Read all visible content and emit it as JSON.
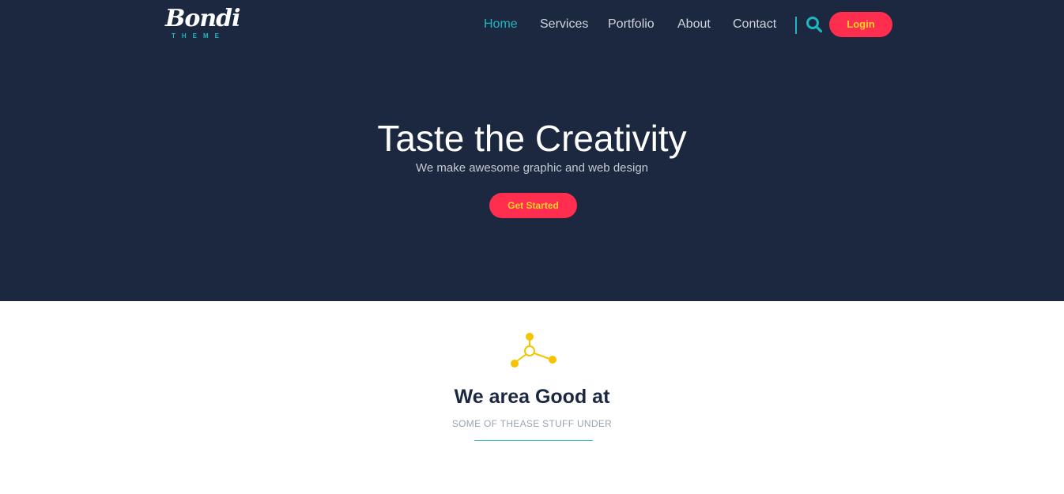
{
  "brand": {
    "name": "Bondi",
    "sub": "THEME"
  },
  "nav": {
    "items": [
      {
        "label": "Home",
        "active": true
      },
      {
        "label": "Services",
        "active": false
      },
      {
        "label": "Portfolio",
        "active": false
      },
      {
        "label": "About",
        "active": false
      },
      {
        "label": "Contact",
        "active": false
      }
    ],
    "login_label": "Login"
  },
  "hero": {
    "title": "Taste the Creativity",
    "subtitle": "We make awesome graphic and web design",
    "cta_label": "Get Started"
  },
  "section": {
    "icon": "molecule-icon",
    "title": "We area Good at",
    "subtitle": "SOME OF THEASE STUFF UNDER"
  },
  "colors": {
    "hero_bg": "#1b2840",
    "accent": "#1fb6c1",
    "button_bg": "#ff2e4f",
    "button_text": "#ffd027",
    "icon_yellow": "#f5c400"
  }
}
